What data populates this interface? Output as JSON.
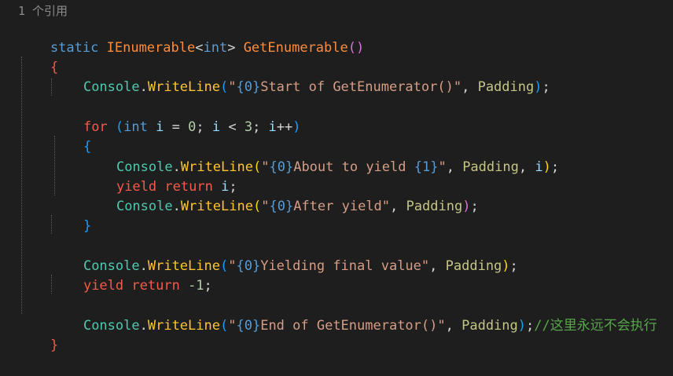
{
  "codelens": "1 个引用",
  "tokens": {
    "static": "static",
    "ienumerable": "IEnumerable",
    "lt": "<",
    "int": "int",
    "gt": ">",
    "method_name": "GetEnumerable",
    "open_paren": "(",
    "close_paren": ")",
    "open_brace": "{",
    "close_brace": "}",
    "console": "Console",
    "dot": ".",
    "writeline": "WriteLine",
    "quote": "\"",
    "fmt0": "{0}",
    "fmt1": "{1}",
    "str_start": "Start of GetEnumerator()",
    "str_about": "About to yield ",
    "str_after": "After yield",
    "str_final": "Yielding final value",
    "str_end": "End of GetEnumerator()",
    "comma_sp": ", ",
    "padding": "Padding",
    "semicolon": ";",
    "for": "for",
    "space": " ",
    "i": "i",
    "eq_zero": " = ",
    "zero": "0",
    "lt_sp": " < ",
    "three": "3",
    "semi_sp": "; ",
    "inc": "++",
    "yield": "yield",
    "return": "return",
    "neg_one": "-1",
    "comment": "//这里永远不会执行"
  }
}
